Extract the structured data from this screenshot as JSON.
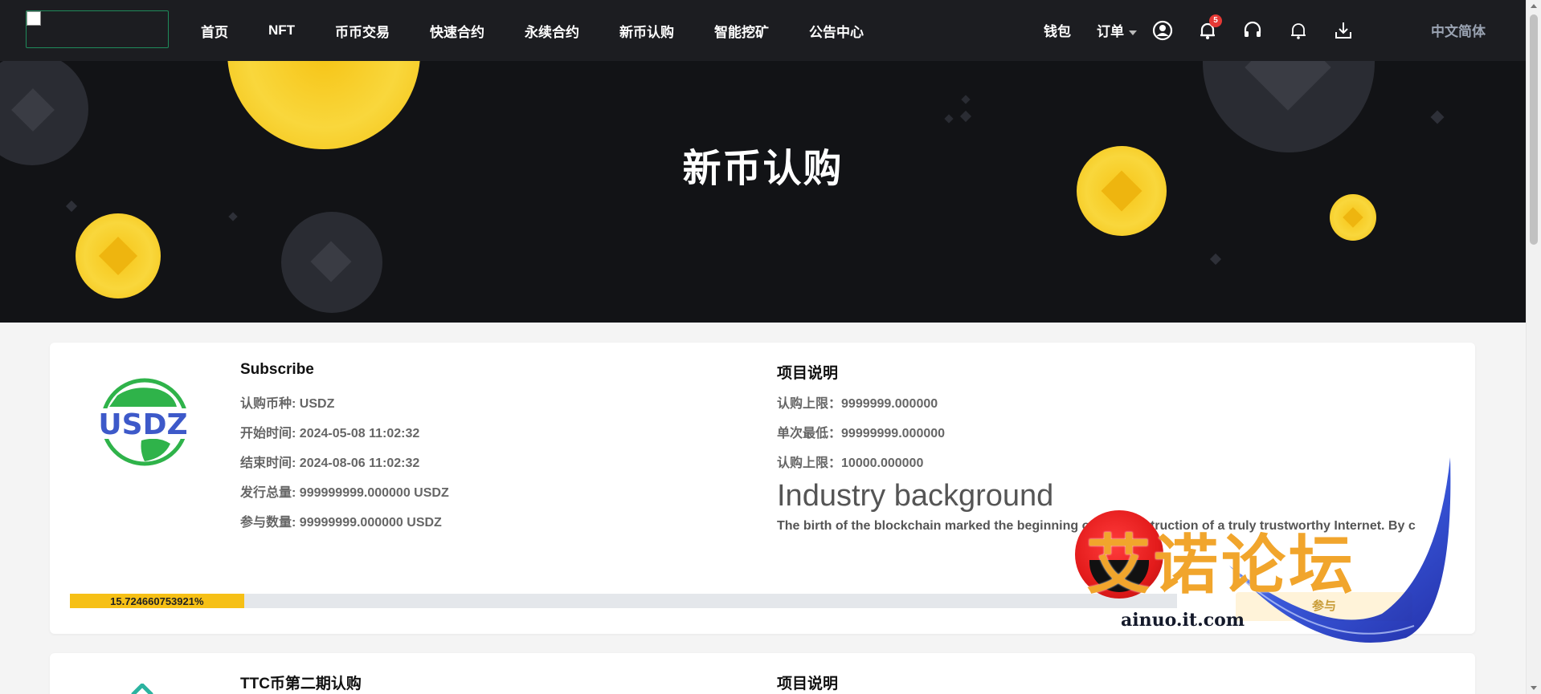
{
  "header": {
    "nav": [
      "首页",
      "NFT",
      "币币交易",
      "快速合约",
      "永续合约",
      "新币认购",
      "智能挖矿",
      "公告中心"
    ],
    "wallet": "钱包",
    "orders": "订单",
    "notification_count": "5",
    "language": "中文简体",
    "icons": [
      "user-circle-icon",
      "bell-icon",
      "headset-icon",
      "bell-outline-icon",
      "download-tray-icon"
    ]
  },
  "hero": {
    "title": "新币认购"
  },
  "projects": [
    {
      "name": "Subscribe",
      "logo_text": "USDZ",
      "rows": [
        {
          "label": "认购币种:",
          "value": "USDZ"
        },
        {
          "label": "开始时间:",
          "value": "2024-05-08 11:02:32"
        },
        {
          "label": "结束时间:",
          "value": "2024-08-06 11:02:32"
        },
        {
          "label": "发行总量:",
          "value": "999999999.000000 USDZ"
        },
        {
          "label": "参与数量:",
          "value": "99999999.000000 USDZ"
        }
      ],
      "desc_title": "项目说明",
      "desc_rows": [
        {
          "label": "认购上限：",
          "value": "9999999.000000"
        },
        {
          "label": "单次最低：",
          "value": "99999999.000000"
        },
        {
          "label": "认购上限：",
          "value": "10000.000000"
        }
      ],
      "industry_title": "Industry background",
      "industry_text": "The birth of the blockchain marked the beginning of the construction of a truly trustworthy Internet. By c",
      "progress_label": "15.724660753921%",
      "progress": 0.1572466,
      "button_partial": "参与"
    },
    {
      "name": "TTC币第二期认购",
      "desc_title": "项目说明"
    }
  ],
  "watermark": {
    "text": "艾诺论坛",
    "url": "ainuo.it.com"
  },
  "colors": {
    "accent": "#f6c016",
    "header_bg": "#1c1d21",
    "hero_bg": "#121316"
  }
}
